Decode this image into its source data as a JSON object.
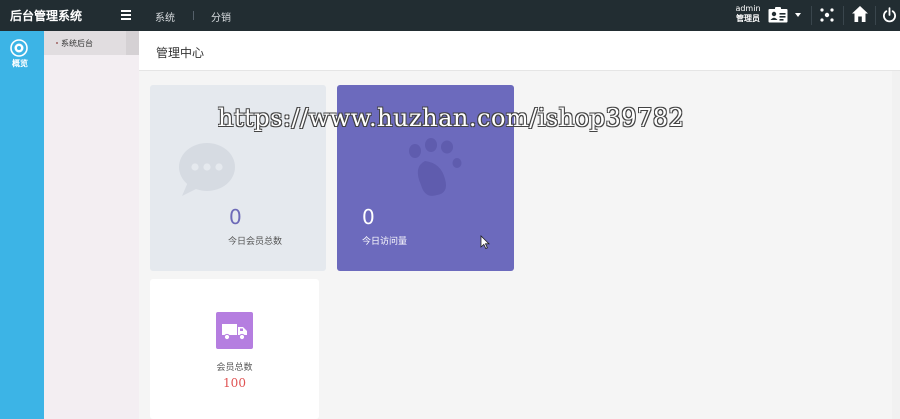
{
  "app": {
    "title": "后台管理系统"
  },
  "topbar": {
    "nav": [
      "系统",
      "分销"
    ],
    "user": {
      "name": "admin",
      "role": "管理员"
    }
  },
  "rail": {
    "items": [
      {
        "label": "概览",
        "icon": "dashboard-icon"
      }
    ]
  },
  "subnav": {
    "items": [
      {
        "label": "系统后台"
      }
    ]
  },
  "main": {
    "title": "管理中心",
    "cards": {
      "members_today": {
        "value": "0",
        "label": "今日会员总数",
        "icon": "chat-bubble-icon",
        "color": "#e5e9ee"
      },
      "visits_today": {
        "value": "0",
        "label": "今日访问量",
        "icon": "paw-icon",
        "color": "#6c6abd"
      },
      "members_total": {
        "value": "100",
        "label": "会员总数",
        "icon": "truck-icon",
        "color": "#b57ee0"
      }
    }
  },
  "overlay": {
    "watermark": "https://www.huzhan.com/ishop39782"
  },
  "colors": {
    "topbar": "#222d32",
    "rail": "#3cb4e6",
    "accent_value": "#e05252"
  }
}
